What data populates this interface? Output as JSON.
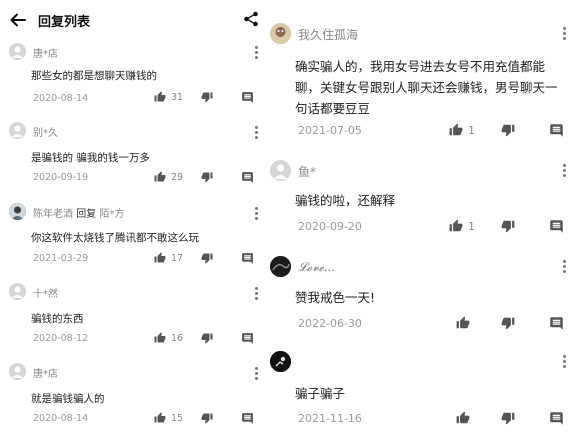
{
  "header": {
    "title": "回复列表",
    "back_icon": "arrow-left-icon",
    "share_icon": "share-icon"
  },
  "left_comments": [
    {
      "user": "唐*店",
      "text": "那些女的都是想聊天赚钱的",
      "date": "2020-08-14",
      "likes": "31"
    },
    {
      "user": "别*久",
      "text": "是骗钱的 骗我的钱一万多",
      "date": "2020-09-19",
      "likes": "29"
    },
    {
      "user": "陈年老酒",
      "reply_word": "回复",
      "reply_to": "陌*方",
      "text": "你这软件太烧钱了腾讯都不敢这么玩",
      "date": "2021-03-29",
      "likes": "17"
    },
    {
      "user": "十*然",
      "text": "骗钱的东西",
      "date": "2020-08-12",
      "likes": "16"
    },
    {
      "user": "唐*店",
      "text": "就是骗钱骗人的",
      "date": "2020-08-14",
      "likes": "15"
    }
  ],
  "right_comments": [
    {
      "user": "我久住孤海",
      "text": "确实骗人的，我用女号进去女号不用充值都能聊，关键女号跟别人聊天还会赚钱，男号聊天一句话都要豆豆",
      "date": "2021-07-05",
      "likes": "1"
    },
    {
      "user": "鱼*",
      "text": "骗钱的啦，还解释",
      "date": "2020-09-20",
      "likes": "1"
    },
    {
      "user": "𝓛𝓸𝓿𝓮...",
      "text": "赞我戒色一天!",
      "date": "2022-06-30",
      "likes": ""
    },
    {
      "user": "",
      "text": "骗子骗子",
      "date": "2021-11-16",
      "likes": ""
    }
  ],
  "icons": {
    "like": "thumb-up-icon",
    "dislike": "thumb-down-icon",
    "reply": "comment-icon",
    "more": "more-vertical-icon"
  },
  "colors": {
    "text": "#222222",
    "meta": "#999999",
    "icon": "#555555",
    "avatar_placeholder": "#d6d6d6"
  }
}
